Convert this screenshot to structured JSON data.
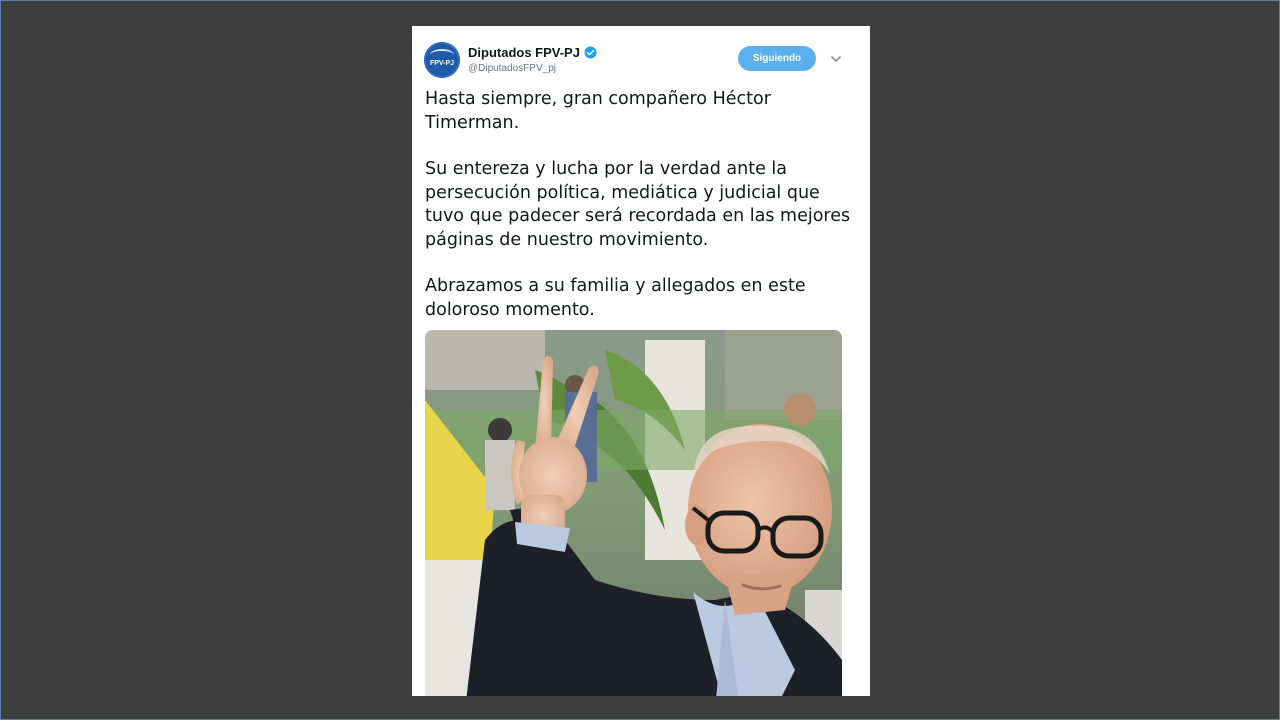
{
  "tweet": {
    "avatar_text": "FPV-PJ",
    "display_name": "Diputados FPV-PJ",
    "handle": "@DiputadosFPV_pj",
    "verified_icon": "verified-badge-icon",
    "follow_button_label": "Siguiendo",
    "menu_icon": "chevron-down-icon",
    "paragraphs": [
      "Hasta siempre, gran compañero Héctor Timerman.",
      "Su entereza y lucha por la verdad ante la persecución política, mediática y judicial que tuvo que padecer será recordada en las mejores páginas de nuestro movimiento.",
      "Abrazamos a su familia y allegados en este doloroso momento."
    ]
  },
  "colors": {
    "background": "#3e3e3e",
    "card": "#ffffff",
    "accent": "#5ab0ec",
    "verified": "#1da1f2",
    "avatar": "#1f5aa8"
  }
}
